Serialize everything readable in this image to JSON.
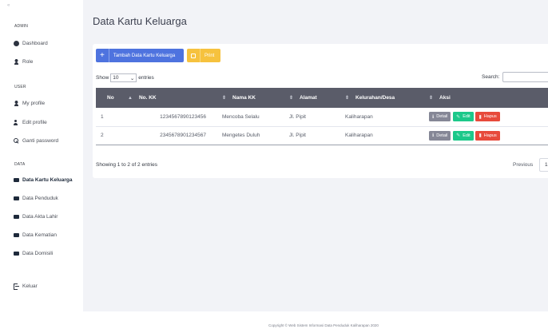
{
  "sidebar": {
    "brand": "«",
    "sections": [
      {
        "title": "ADMIN"
      },
      {
        "title": "USER"
      },
      {
        "title": "DATA"
      }
    ],
    "items": [
      {
        "label": "Dashboard",
        "icon": "dashboard-icon"
      },
      {
        "label": "Role",
        "icon": "user-icon"
      },
      {
        "label": "My profile",
        "icon": "user-icon"
      },
      {
        "label": "Edit profile",
        "icon": "user-edit-icon"
      },
      {
        "label": "Ganti password",
        "icon": "key-icon"
      },
      {
        "label": "Data Kartu Keluarga",
        "icon": "folder-icon",
        "active": true
      },
      {
        "label": "Data Penduduk",
        "icon": "folder-icon"
      },
      {
        "label": "Data Akta Lahir",
        "icon": "folder-icon"
      },
      {
        "label": "Data Kematian",
        "icon": "folder-icon"
      },
      {
        "label": "Data Domisili",
        "icon": "folder-icon"
      },
      {
        "label": "Keluar",
        "icon": "sign-out-icon"
      }
    ]
  },
  "main": {
    "title": "Data Kartu Keluarga",
    "buttons": {
      "add_icon": "+",
      "add": "Tambah Data Kartu Keluarga",
      "print": "Print"
    },
    "show_entries": {
      "prefix": "Show",
      "value": "10",
      "suffix": "entries"
    },
    "search_label": "Search:",
    "table": {
      "columns": [
        "No",
        "No. KK",
        "Nama KK",
        "Alamat",
        "Kelurahan/Desa",
        "Aksi"
      ],
      "rows": [
        {
          "no": "1",
          "no_kk": "1234567890123456",
          "nama": "Mencoba Selalu",
          "alamat": "Jl. Pipit",
          "kelurahan": "Kaliharapan"
        },
        {
          "no": "2",
          "no_kk": "2345678901234567",
          "nama": "Mengetes Duluh",
          "alamat": "Jl. Pipit",
          "kelurahan": "Kaliharapan"
        }
      ],
      "actions": {
        "detail": "Detail",
        "edit": "Edit",
        "hapus": "Hapus"
      }
    },
    "info": "Showing 1 to 2 of 2 entries",
    "pagination": {
      "previous": "Previous",
      "page": "1"
    }
  },
  "footer": "Copyright © Web Sistem Informasi Data Penduduk Kaliharapan 2020",
  "colors": {
    "primary": "#4e73df",
    "warning": "#f6c23e",
    "success": "#1cc88a",
    "danger": "#e74a3b",
    "secondary": "#858796",
    "table_header": "#5a5c69"
  }
}
